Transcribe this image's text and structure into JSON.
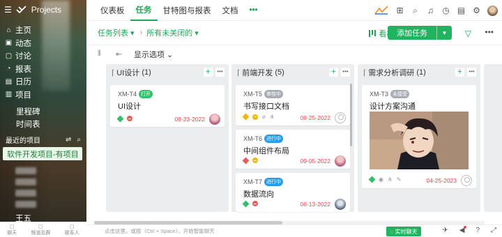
{
  "app": {
    "brand": "Projects"
  },
  "sidebar": {
    "nav": [
      {
        "label": "主页",
        "icon": "home-icon"
      },
      {
        "label": "动态",
        "icon": "activity-icon"
      },
      {
        "label": "讨论",
        "icon": "discussion-icon"
      },
      {
        "label": "报表",
        "icon": "report-icon"
      },
      {
        "label": "日历",
        "icon": "calendar-icon"
      },
      {
        "label": "项目",
        "icon": "project-icon"
      }
    ],
    "sub": [
      "里程碑",
      "时间表"
    ],
    "recent_label": "最近的项目",
    "active_project": "软件开发项目-有项目",
    "user": "王五",
    "bottom": [
      "聊天",
      "频道及群",
      "联系人"
    ]
  },
  "topnav": {
    "tabs": [
      "仪表板",
      "任务",
      "甘特图与报表",
      "文档"
    ],
    "active": "任务",
    "more": "•••"
  },
  "toolbar": {
    "task_list": "任务列表",
    "filter_label": "所有未关闭的",
    "view": "看板",
    "add_task": "添加任务"
  },
  "toolbar3": {
    "display_options": "显示选项"
  },
  "columns": [
    {
      "title": "UI设计",
      "count": "(1)",
      "cards": [
        {
          "id": "XM-T4",
          "status": "打开",
          "status_color": "#34c06a",
          "title": "UI设计",
          "date": "08-23-2022"
        }
      ]
    },
    {
      "title": "前端开发",
      "count": "(5)",
      "cards": [
        {
          "id": "XM-T5",
          "status": "审核中",
          "status_color": "#a8adb4",
          "title": "书写接口文档",
          "date": "08-25-2022"
        },
        {
          "id": "XM-T6",
          "status": "进行中",
          "status_color": "#2a9be8",
          "title": "中间组件布局",
          "date": "09-05-2022"
        },
        {
          "id": "XM-T7",
          "status": "进行中",
          "status_color": "#2a9be8",
          "title": "数据流向",
          "date": "08-13-2022"
        }
      ]
    },
    {
      "title": "需求分析调研",
      "count": "(1)",
      "cards": [
        {
          "id": "XM-T3",
          "status": "未接受",
          "status_color": "#a8adb4",
          "title": "设计方案沟通",
          "date": "04-25-2023"
        }
      ]
    }
  ],
  "bottom": {
    "hint": "点击这里。或按（Ctrl + Space），开始智能聊天",
    "chat": "实时聊天"
  }
}
